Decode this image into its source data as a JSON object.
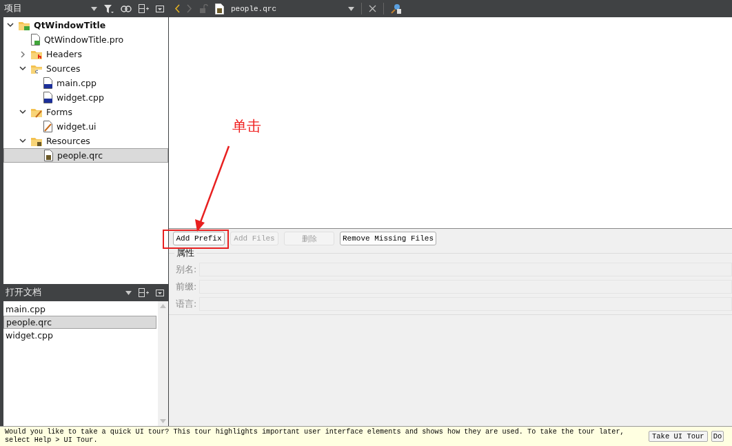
{
  "project_panel": {
    "title": "项目",
    "tree": [
      {
        "label": "QtWindowTitle",
        "kind": "project",
        "expanded": true,
        "selected": false,
        "children": [
          {
            "label": "QtWindowTitle.pro",
            "kind": "pro-file",
            "selected": false
          },
          {
            "label": "Headers",
            "kind": "header-folder",
            "expanded": false,
            "selected": false
          },
          {
            "label": "Sources",
            "kind": "source-folder",
            "expanded": true,
            "selected": false,
            "children": [
              {
                "label": "main.cpp",
                "kind": "cpp-file",
                "selected": false
              },
              {
                "label": "widget.cpp",
                "kind": "cpp-file",
                "selected": false
              }
            ]
          },
          {
            "label": "Forms",
            "kind": "form-folder",
            "expanded": true,
            "selected": false,
            "children": [
              {
                "label": "widget.ui",
                "kind": "ui-file",
                "selected": false
              }
            ]
          },
          {
            "label": "Resources",
            "kind": "resource-folder",
            "expanded": true,
            "selected": false,
            "children": [
              {
                "label": "people.qrc",
                "kind": "qrc-file",
                "selected": true
              }
            ]
          }
        ]
      }
    ]
  },
  "open_documents": {
    "title": "打开文档",
    "items": [
      {
        "label": "main.cpp",
        "selected": false
      },
      {
        "label": "people.qrc",
        "selected": true
      },
      {
        "label": "widget.cpp",
        "selected": false
      }
    ]
  },
  "editor": {
    "file": "people.qrc",
    "buttons": [
      {
        "label": "Add Prefix",
        "disabled": false
      },
      {
        "label": "Add Files",
        "disabled": true
      },
      {
        "label": "删除",
        "disabled": true
      },
      {
        "label": "Remove Missing Files",
        "disabled": false
      }
    ],
    "properties": {
      "title": "属性",
      "fields": [
        {
          "label": "别名:"
        },
        {
          "label": "前缀:"
        },
        {
          "label": "语言:"
        }
      ]
    }
  },
  "annotation": {
    "text": "单击"
  },
  "tour_bar": {
    "message": "Would you like to take a quick UI tour? This tour highlights important user interface elements and shows how they are used. To take the tour later, select Help > UI Tour.",
    "buttons": [
      "Take UI Tour",
      "Do"
    ]
  }
}
